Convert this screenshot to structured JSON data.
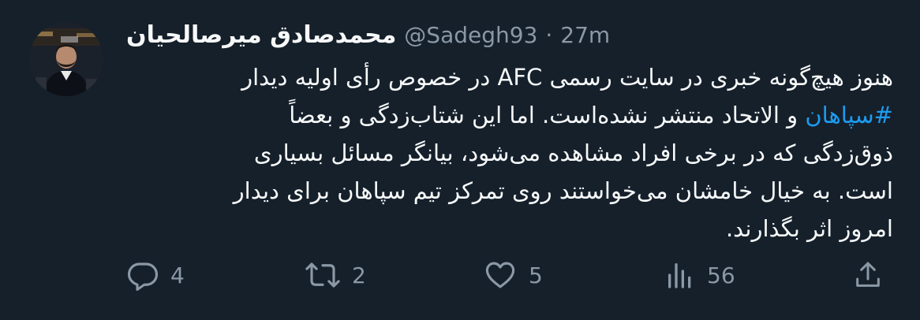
{
  "tweet": {
    "display_name": "محمدصادق میرصالحیان",
    "handle": "@Sadegh93",
    "separator": "·",
    "time": "27m",
    "body": {
      "line1": "هنوز هیچ‌گونه خبری در سایت رسمی AFC در خصوص رأی اولیه دیدار",
      "hashtag": "#سپاهان",
      "line2_rest": " و الاتحاد منتشر نشده‌است. اما این شتاب‌زدگی و بعضاً",
      "line3": "ذوق‌زدگی که در برخی افراد مشاهده می‌شود، بیانگر مسائل بسیاری",
      "line4": "است. به خیال خامشان می‌خواستند روی تمرکز تیم سپاهان برای دیدار",
      "line5": "امروز اثر بگذارند."
    },
    "actions": {
      "reply_count": "4",
      "retweet_count": "2",
      "like_count": "5",
      "views_count": "56"
    },
    "icons": {
      "reply": "reply-icon",
      "retweet": "retweet-icon",
      "like": "heart-icon",
      "views": "views-icon",
      "share": "share-icon"
    },
    "colors": {
      "background": "#15202b",
      "text": "#f7f9f9",
      "muted": "#8b98a5",
      "link": "#1d9bf0"
    }
  }
}
